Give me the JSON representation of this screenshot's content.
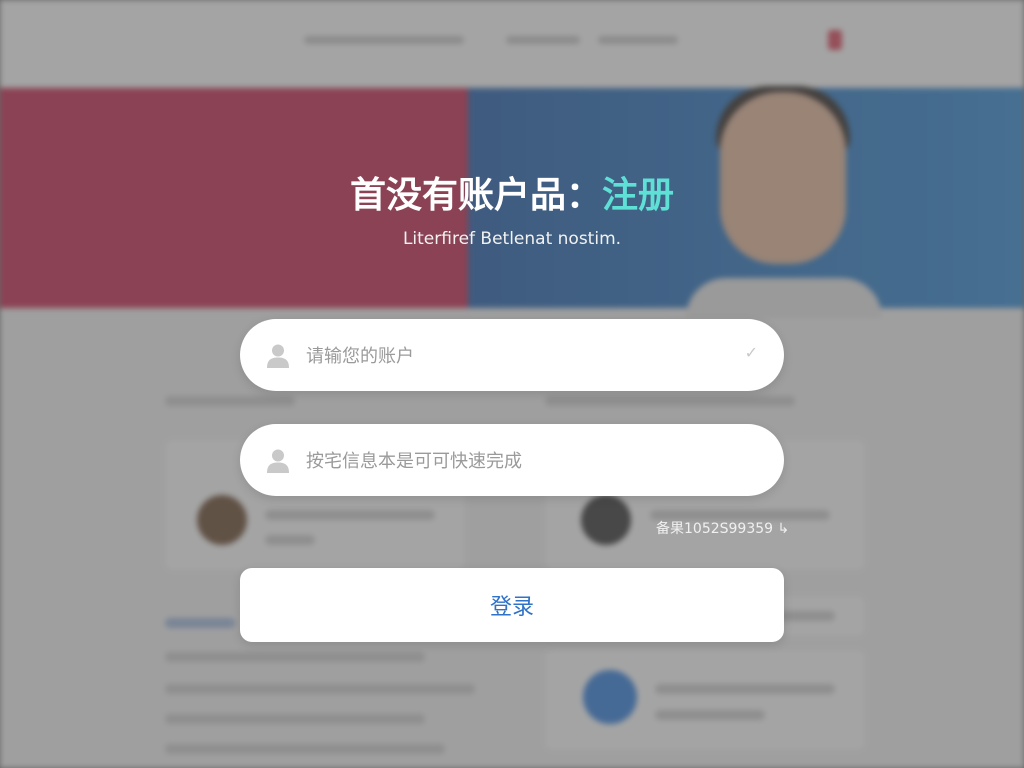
{
  "background": {
    "logo_text": "",
    "banner_heading": "",
    "banner_subtext": "",
    "section_title": ""
  },
  "promo": {
    "title_prefix": "首没有账户品：",
    "title_link": "注册",
    "subtitle": "Literfiref Betlenat nostim."
  },
  "form": {
    "account_placeholder": "请输您的账户",
    "info_placeholder": "按宅信息本是可可快速完成",
    "login_label": "登录"
  },
  "phone_hint": "备果1052S99359 ↳",
  "colors": {
    "link_accent": "#5fe0d6",
    "button_text": "#2f72c8",
    "banner_red": "#c8264e",
    "banner_blue": "#1f5fae"
  },
  "icons": {
    "account_field": "user-icon",
    "info_field": "user-icon",
    "account_check": "check-icon"
  }
}
